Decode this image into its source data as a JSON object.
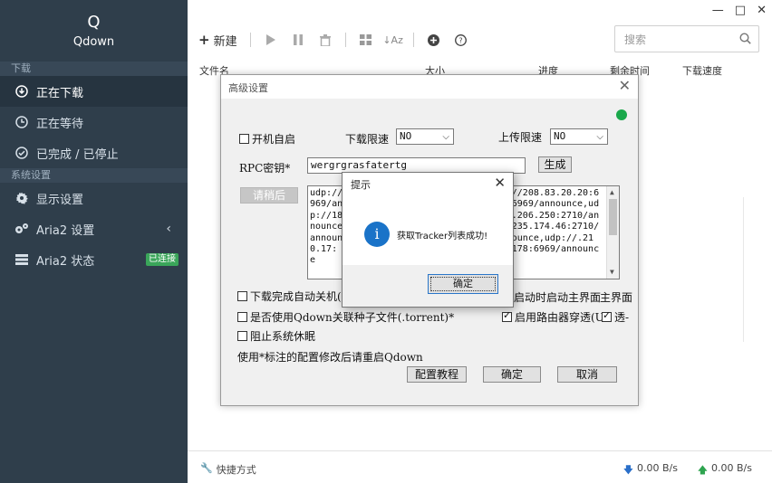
{
  "app": {
    "logo_letter": "Q",
    "name": "Qdown"
  },
  "sidebar": {
    "section_download": "下载",
    "section_settings": "系统设置",
    "items": [
      {
        "label": "正在下载",
        "icon": "download-circle-icon"
      },
      {
        "label": "正在等待",
        "icon": "clock-icon"
      },
      {
        "label": "已完成 / 已停止",
        "icon": "check-circle-icon"
      },
      {
        "label": "显示设置",
        "icon": "gear-icon"
      },
      {
        "label": "Aria2 设置",
        "icon": "gears-icon"
      },
      {
        "label": "Aria2 状态",
        "icon": "server-icon",
        "badge": "已连接"
      }
    ]
  },
  "window_controls": {
    "minimize": "—",
    "maximize": "□",
    "close": "✕"
  },
  "toolbar": {
    "new_label": "新建"
  },
  "search": {
    "placeholder": "搜索"
  },
  "columns": {
    "name": "文件名",
    "size": "大小",
    "progress": "进度",
    "remaining": "剩余时间",
    "speed": "下载速度"
  },
  "statusbar": {
    "shortcut": "快捷方式",
    "download_speed": "0.00 B/s",
    "upload_speed": "0.00 B/s"
  },
  "advanced_dialog": {
    "title": "高级设置",
    "autostart": "开机自启",
    "download_limit_label": "下载限速",
    "download_limit_value": "NO",
    "upload_limit_label": "上传限速",
    "upload_limit_value": "NO",
    "rpc_label": "RPC密钥*",
    "rpc_value": "wergrgrasfatertg",
    "generate_button": "生成",
    "wait_button": "请稍后",
    "tracker_text": "udp://62.210.97.59:1337/announce,udp://208.83.20.20:6969/announce,udp://142.44.241.58.209:6969/announce,udp://185.181.60.67:80/announce,udp://5.206.250:2710/announce,udp://:6969/announce,udp://37.235.174.46:2710/announce,udp://89.234.156.205:451/announce,udp://.210.17: 6969/announce,udp://95.223.105.178:6969/announce",
    "auto_shutdown": "下载完成自动关机(没",
    "assoc_torrent": "是否使用Qdown关联种子文件(.torrent)*",
    "prevent_sleep": "阻止系统休眠",
    "launch_main": "启动时启动主界面",
    "main_ui": "主界面",
    "upnp": "启用路由器穿透(UP",
    "transparent": "透-",
    "note": "使用*标注的配置修改后请重启Qdown",
    "config_tutorial": "配置教程",
    "confirm": "确定",
    "cancel": "取消"
  },
  "prompt": {
    "title": "提示",
    "message": "获取Tracker列表成功!",
    "ok": "确定"
  }
}
